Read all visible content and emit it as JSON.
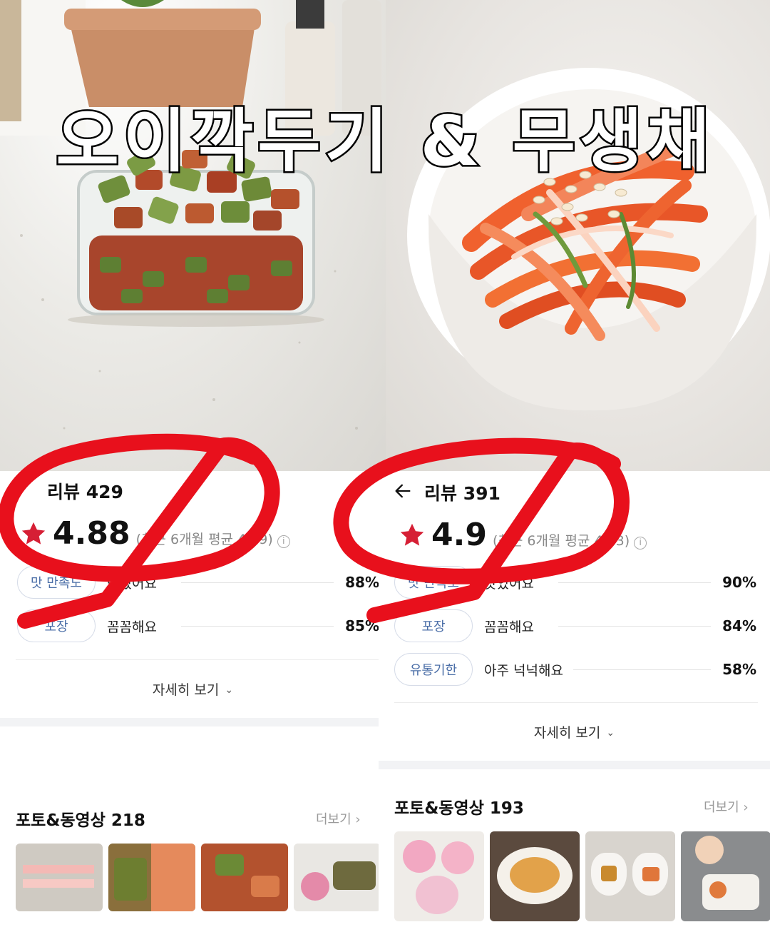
{
  "title_overlay": "오이깍두기 & 무생채",
  "left": {
    "review_label": "리뷰 429",
    "rating": "4.88",
    "avg_text": "(최근 6개월 평균 4.89)",
    "info_glyph": "i",
    "attributes": [
      {
        "tag": "맛 만족도",
        "label": "맛있어요",
        "percent": "88%"
      },
      {
        "tag": "포장",
        "label": "꼼꼼해요",
        "percent": "85%"
      }
    ],
    "more_detail": "자세히 보기",
    "media_title": "포토&동영상 218",
    "more_link": "더보기 ›"
  },
  "right": {
    "review_label": "리뷰 391",
    "rating": "4.9",
    "avg_text": "(최근 6개월 평균 4.83)",
    "info_glyph": "i",
    "attributes": [
      {
        "tag": "맛 만족도",
        "label": "맛있어요",
        "percent": "90%"
      },
      {
        "tag": "포장",
        "label": "꼼꼼해요",
        "percent": "84%"
      },
      {
        "tag": "유통기한",
        "label": "아주 넉넉해요",
        "percent": "58%"
      }
    ],
    "more_detail": "자세히 보기",
    "media_title": "포토&동영상 193",
    "more_link": "더보기 ›"
  },
  "colors": {
    "star": "#d61f35",
    "pill_text": "#4c6fa8",
    "pill_border": "#d6dce8",
    "marker": "#e8101c"
  }
}
